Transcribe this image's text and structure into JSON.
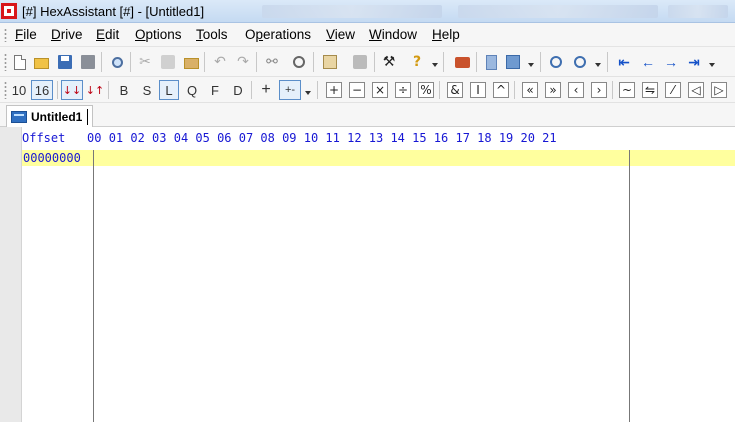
{
  "window": {
    "title": "[#] HexAssistant [#] - [Untitled1]"
  },
  "menu": {
    "items": [
      {
        "accel": "F",
        "rest": "ile"
      },
      {
        "accel": "D",
        "rest": "rive"
      },
      {
        "accel": "E",
        "rest": "dit"
      },
      {
        "accel": "O",
        "rest": "ptions"
      },
      {
        "accel": "T",
        "rest": "ools"
      },
      {
        "accel": "",
        "pre": "O",
        "mid": "p",
        "rest": "erations"
      },
      {
        "accel": "V",
        "rest": "iew"
      },
      {
        "accel": "W",
        "rest": "indow"
      },
      {
        "accel": "H",
        "rest": "elp"
      }
    ]
  },
  "toolbar2": {
    "base10": "10",
    "base16": "16",
    "width_b": "B",
    "width_s": "S",
    "width_l": "L",
    "width_q": "Q",
    "width_f": "F",
    "width_d": "D",
    "op_add": "+",
    "op_minus_label": "+-",
    "bool_and": "&",
    "bool_or": "I",
    "bool_xor": "^"
  },
  "document": {
    "tab_label": "Untitled1"
  },
  "hex": {
    "header": "Offset   00 01 02 03 04 05 06 07 08 09 10 11 12 13 14 15 16 17 18 19 20 21",
    "rows": [
      {
        "offset": "00000000"
      }
    ]
  }
}
